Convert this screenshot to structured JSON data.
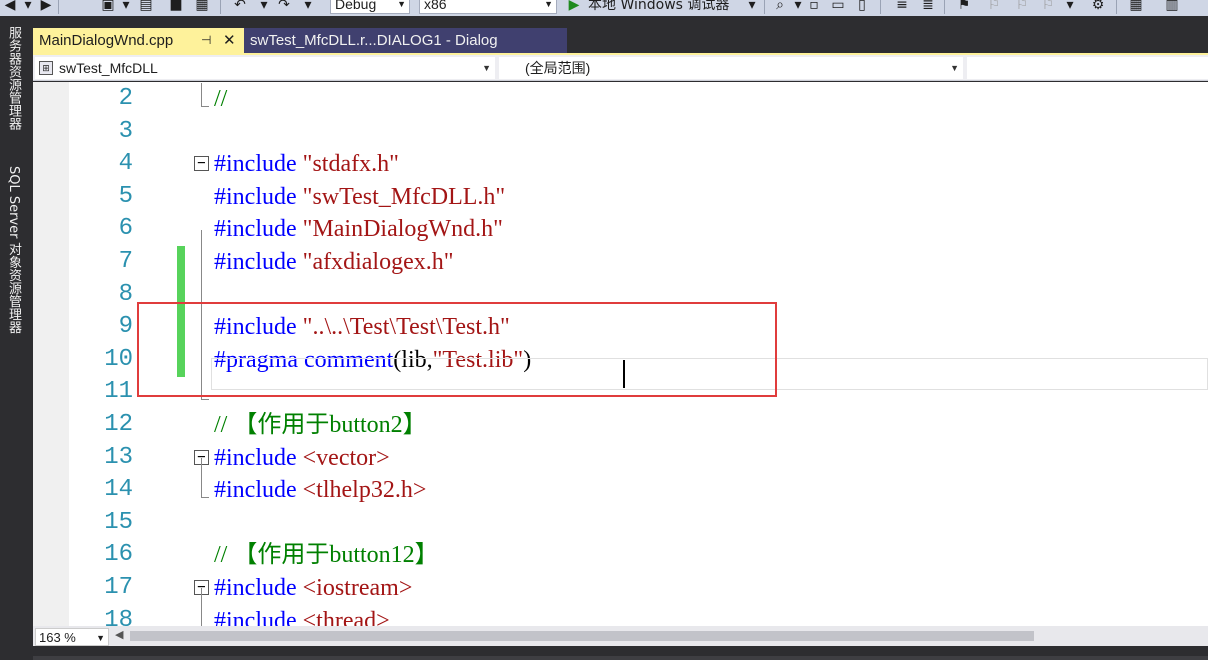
{
  "toolbar": {
    "config_value": "Debug",
    "platform_value": "x86",
    "run_label": "本地 Windows 调试器"
  },
  "side_tabs": {
    "server_explorer": "服务器资源管理器",
    "sql_explorer": "SQL Server 对象资源管理器"
  },
  "tabs": [
    {
      "label": "MainDialogWnd.cpp",
      "active": true
    },
    {
      "label": "swTest_MfcDLL.r...DIALOG1 - Dialog",
      "active": false
    }
  ],
  "tab_icons": {
    "pin": "pin-icon",
    "close": "close-icon"
  },
  "navigation": {
    "project": "swTest_MfcDLL",
    "scope": "(全局范围)",
    "member": ""
  },
  "editor": {
    "lines": [
      {
        "num": "2",
        "tokens": [
          {
            "t": "//",
            "c": "cm"
          }
        ]
      },
      {
        "num": "3",
        "tokens": []
      },
      {
        "num": "4",
        "tokens": [
          {
            "t": "#include",
            "c": "kw"
          },
          {
            "t": " ",
            "c": "plain"
          },
          {
            "t": "\"stdafx.h\"",
            "c": "str"
          }
        ]
      },
      {
        "num": "5",
        "tokens": [
          {
            "t": "#include",
            "c": "kw"
          },
          {
            "t": " ",
            "c": "plain"
          },
          {
            "t": "\"swTest_MfcDLL.h\"",
            "c": "str"
          }
        ]
      },
      {
        "num": "6",
        "tokens": [
          {
            "t": "#include",
            "c": "kw"
          },
          {
            "t": " ",
            "c": "plain"
          },
          {
            "t": "\"MainDialogWnd.h\"",
            "c": "str"
          }
        ]
      },
      {
        "num": "7",
        "tokens": [
          {
            "t": "#include",
            "c": "kw"
          },
          {
            "t": " ",
            "c": "plain"
          },
          {
            "t": "\"afxdialogex.h\"",
            "c": "str"
          }
        ]
      },
      {
        "num": "8",
        "tokens": []
      },
      {
        "num": "9",
        "tokens": [
          {
            "t": "#include",
            "c": "kw"
          },
          {
            "t": " ",
            "c": "plain"
          },
          {
            "t": "\"..\\..\\Test\\Test\\Test.h\"",
            "c": "str"
          }
        ]
      },
      {
        "num": "10",
        "tokens": [
          {
            "t": "#pragma",
            "c": "kw"
          },
          {
            "t": " ",
            "c": "plain"
          },
          {
            "t": "comment",
            "c": "kw"
          },
          {
            "t": "(lib,",
            "c": "plain"
          },
          {
            "t": "\"Test.lib\"",
            "c": "str"
          },
          {
            "t": ")",
            "c": "plain"
          }
        ]
      },
      {
        "num": "11",
        "tokens": []
      },
      {
        "num": "12",
        "tokens": [
          {
            "t": "// 【作用于button2】",
            "c": "cm"
          }
        ]
      },
      {
        "num": "13",
        "tokens": [
          {
            "t": "#include",
            "c": "kw"
          },
          {
            "t": " ",
            "c": "plain"
          },
          {
            "t": "<vector>",
            "c": "str"
          }
        ]
      },
      {
        "num": "14",
        "tokens": [
          {
            "t": "#include",
            "c": "kw"
          },
          {
            "t": " ",
            "c": "plain"
          },
          {
            "t": "<tlhelp32.h>",
            "c": "str"
          }
        ]
      },
      {
        "num": "15",
        "tokens": []
      },
      {
        "num": "16",
        "tokens": [
          {
            "t": "// 【作用于button12】",
            "c": "cm"
          }
        ]
      },
      {
        "num": "17",
        "tokens": [
          {
            "t": "#include",
            "c": "kw"
          },
          {
            "t": " ",
            "c": "plain"
          },
          {
            "t": "<iostream>",
            "c": "str"
          }
        ]
      },
      {
        "num": "18",
        "tokens": [
          {
            "t": "#include",
            "c": "kw"
          },
          {
            "t": " ",
            "c": "plain"
          },
          {
            "t": "<thread>",
            "c": "str"
          }
        ]
      }
    ],
    "changed_lines": [
      "7",
      "8",
      "9",
      "10"
    ],
    "collapsible_lines": [
      "4",
      "13",
      "17"
    ]
  },
  "zoom": "163 %",
  "colors": {
    "keyword": "#0000ff",
    "string": "#a31515",
    "comment": "#008000",
    "line_number": "#2b91af",
    "change_marker": "#57d35b",
    "active_tab": "#fef29b",
    "annotation_box": "#e03c3c"
  }
}
